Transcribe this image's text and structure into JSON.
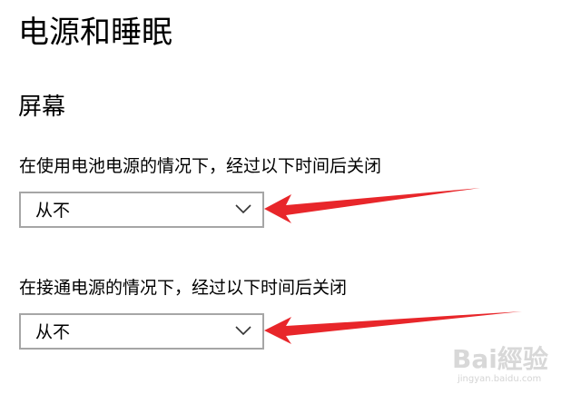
{
  "page": {
    "title": "电源和睡眠"
  },
  "screen_section": {
    "title": "屏幕",
    "battery": {
      "label": "在使用电池电源的情况下，经过以下时间后关闭",
      "selected_value": "从不"
    },
    "plugged_in": {
      "label": "在接通电源的情况下，经过以下时间后关闭",
      "selected_value": "从不"
    }
  },
  "annotations": {
    "arrow_color": "#e8262a"
  },
  "watermark": {
    "logo_text": "Bai經验",
    "sub_text": "jingyan.baidu.com"
  }
}
